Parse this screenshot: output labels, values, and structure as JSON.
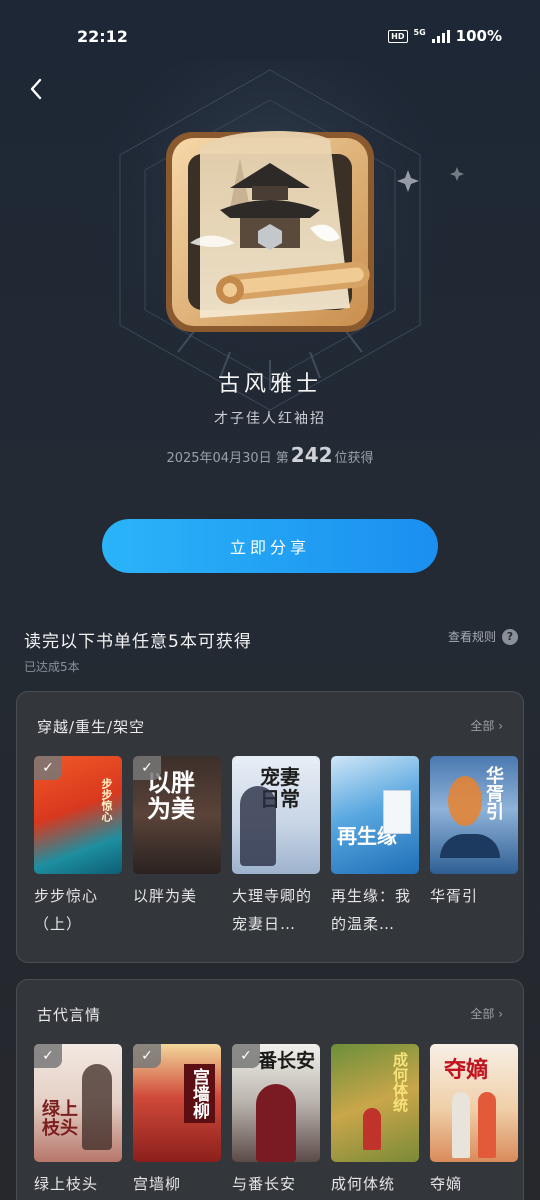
{
  "status": {
    "time": "22:12",
    "hd": "HD",
    "network": "5G",
    "battery": "100%"
  },
  "badge": {
    "title": "古风雅士",
    "subtitle": "才子佳人红袖招",
    "date_prefix": "2025年04月30日",
    "rank_prefix": "第",
    "rank": "242",
    "rank_suffix": "位获得"
  },
  "share_label": "立即分享",
  "task": {
    "title": "读完以下书单任意5本可获得",
    "progress": "已达成5本",
    "rules_label": "查看规则",
    "rules_icon": "?"
  },
  "sections": [
    {
      "title": "穿越/重生/架空",
      "all_label": "全部 ›",
      "books": [
        {
          "title": "步步惊心（上）",
          "checked": true,
          "cover_text": "步步惊心"
        },
        {
          "title": "以胖为美",
          "checked": true,
          "cover_text": "以胖为美"
        },
        {
          "title": "大理寺卿的宠妻日…",
          "checked": false,
          "cover_text": "宠妻日常"
        },
        {
          "title": "再生缘：我的温柔…",
          "checked": false,
          "cover_text": "再生缘"
        },
        {
          "title": "华胥引",
          "checked": false,
          "cover_text": "华胥引"
        }
      ]
    },
    {
      "title": "古代言情",
      "all_label": "全部 ›",
      "books": [
        {
          "title": "绿上枝头",
          "checked": true,
          "cover_text": "绿上枝头"
        },
        {
          "title": "宫墙柳",
          "checked": true,
          "cover_text": "宫墙柳"
        },
        {
          "title": "与番长安",
          "checked": true,
          "cover_text": "番长安"
        },
        {
          "title": "成何体统",
          "checked": false,
          "cover_text": "成何体统"
        },
        {
          "title": "夺嫡",
          "checked": false,
          "cover_text": "夺嫡"
        }
      ]
    }
  ],
  "icons": {
    "back": "chevron-left-icon",
    "check": "check-icon",
    "badge": "pavilion-scroll-badge"
  },
  "colors": {
    "accent": "#1a8ff0",
    "accent_light": "#2bb4f8",
    "card_bg": "#33363b",
    "badge_gold": "#d9a86a"
  }
}
